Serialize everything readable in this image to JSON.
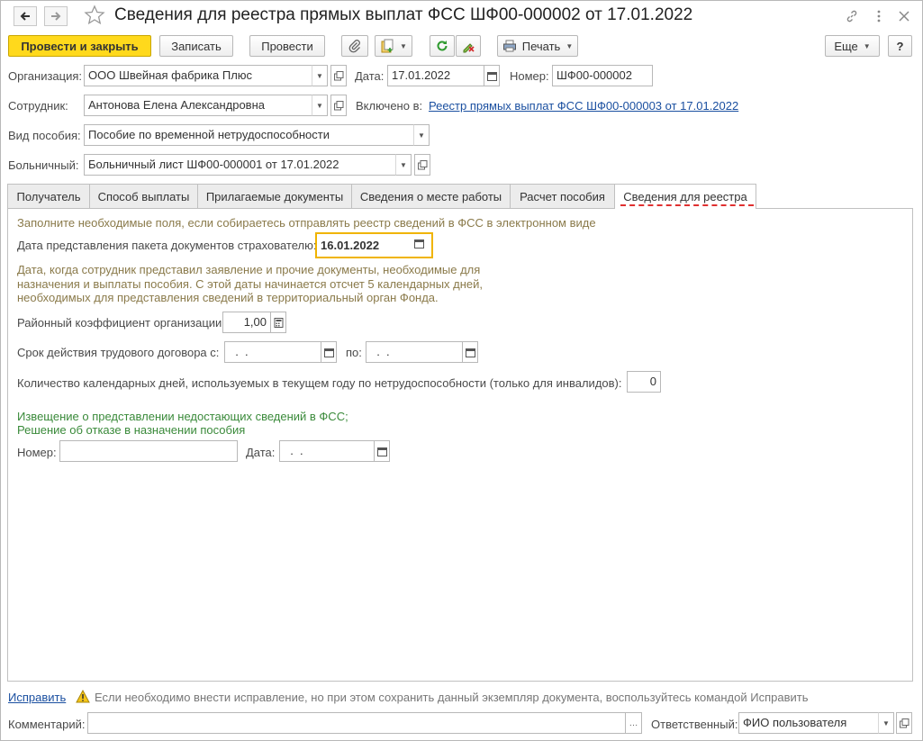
{
  "window": {
    "title": "Сведения для реестра прямых выплат ФСС ШФ00-000002 от 17.01.2022"
  },
  "toolbar": {
    "post_close": "Провести и закрыть",
    "save": "Записать",
    "post": "Провести",
    "print": "Печать",
    "more": "Еще",
    "help": "?"
  },
  "header": {
    "org_label": "Организация:",
    "org_value": "ООО Швейная фабрика Плюс",
    "date_label": "Дата:",
    "date_value": "17.01.2022",
    "number_label": "Номер:",
    "number_value": "ШФ00-000002",
    "employee_label": "Сотрудник:",
    "employee_value": "Антонова Елена Александровна",
    "included_label": "Включено в:",
    "included_link": "Реестр прямых выплат ФСС ШФ00-000003 от 17.01.2022",
    "benefit_label": "Вид пособия:",
    "benefit_value": "Пособие по временной нетрудоспособности",
    "sick_label": "Больничный:",
    "sick_value": "Больничный лист ШФ00-000001 от 17.01.2022"
  },
  "tabs": [
    {
      "label": "Получатель"
    },
    {
      "label": "Способ выплаты"
    },
    {
      "label": "Прилагаемые документы"
    },
    {
      "label": "Сведения о месте работы"
    },
    {
      "label": "Расчет пособия"
    },
    {
      "label": "Сведения для реестра"
    }
  ],
  "active_tab": "Сведения для реестра",
  "panel": {
    "intro_hint": "Заполните необходимые поля, если собираетесь отправлять реестр сведений в ФСС в электронном виде",
    "docs_date_label": "Дата представления пакета документов страхователю:",
    "docs_date_value": "16.01.2022",
    "docs_hint_1": "Дата, когда сотрудник представил заявление и прочие документы, необходимые для",
    "docs_hint_2": "назначения и выплаты пособия. С этой даты начинается отсчет 5 календарных дней,",
    "docs_hint_3": "необходимых для представления сведений в территориальный орган Фонда.",
    "coef_label": "Районный коэффициент организации:",
    "coef_value": "1,00",
    "contract_label": "Срок действия трудового договора с:",
    "contract_from": "  .  .",
    "contract_to_label": "по:",
    "contract_to": "  .  .",
    "days_label": "Количество календарных дней, используемых в текущем году по нетрудоспособности (только для инвалидов):",
    "days_value": "0",
    "notice_1": "Извещение о представлении недостающих сведений в ФСС;",
    "notice_2": "Решение об отказе в назначении пособия",
    "num_label": "Номер:",
    "num_value": "",
    "date_label": "Дата:",
    "date_value": "  .  ."
  },
  "footer": {
    "fix_link": "Исправить",
    "fix_hint": "Если необходимо внести исправление, но при этом сохранить данный экземпляр документа, воспользуйтесь командой Исправить",
    "comment_label": "Комментарий:",
    "comment_value": "",
    "responsible_label": "Ответственный:",
    "responsible_value": "ФИО пользователя"
  },
  "colors": {
    "primary_button": "#ffd91c",
    "link": "#1a4fa0",
    "hint_text": "#8a7a4a",
    "green_text": "#3a8a3a",
    "focus_border": "#f0b400"
  }
}
